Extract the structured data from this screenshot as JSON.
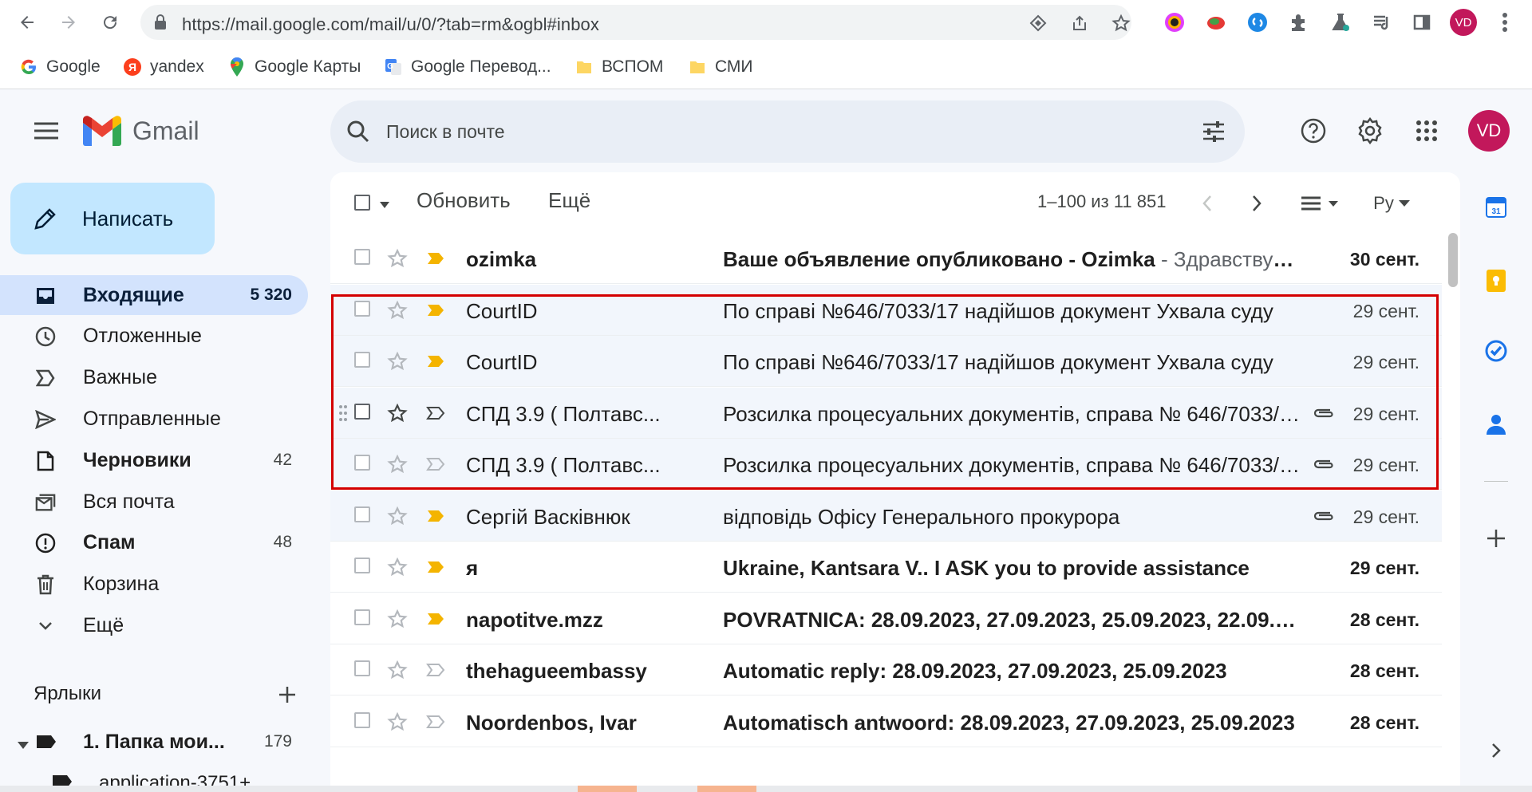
{
  "browser": {
    "url": "https://mail.google.com/mail/u/0/?tab=rm&ogbl#inbox",
    "profile_initials": "VD",
    "bookmarks": [
      {
        "label": "Google",
        "icon": "google-icon"
      },
      {
        "label": "yandex",
        "icon": "yandex-icon"
      },
      {
        "label": "Google Карты",
        "icon": "maps-icon"
      },
      {
        "label": "Google Перевод...",
        "icon": "translate-icon"
      },
      {
        "label": "ВСПОМ",
        "icon": "folder-icon"
      },
      {
        "label": "СМИ",
        "icon": "folder-icon"
      }
    ]
  },
  "header": {
    "app_name": "Gmail",
    "search_placeholder": "Поиск в почте",
    "avatar_initials": "VD"
  },
  "sidebar": {
    "compose_label": "Написать",
    "items": [
      {
        "label": "Входящие",
        "count": "5 320",
        "icon": "inbox-icon"
      },
      {
        "label": "Отложенные",
        "count": "",
        "icon": "clock-icon"
      },
      {
        "label": "Важные",
        "count": "",
        "icon": "important-icon"
      },
      {
        "label": "Отправленные",
        "count": "",
        "icon": "send-icon"
      },
      {
        "label": "Черновики",
        "count": "42",
        "icon": "draft-icon"
      },
      {
        "label": "Вся почта",
        "count": "",
        "icon": "all-mail-icon"
      },
      {
        "label": "Спам",
        "count": "48",
        "icon": "spam-icon"
      },
      {
        "label": "Корзина",
        "count": "",
        "icon": "trash-icon"
      },
      {
        "label": "Ещё",
        "count": "",
        "icon": "chevron-down-icon"
      }
    ],
    "labels_heading": "Ярлыки",
    "labels": [
      {
        "label": "1. Папка мои...",
        "count": "179"
      },
      {
        "label": "application-3751+",
        "count": ""
      }
    ]
  },
  "toolbar": {
    "refresh_label": "Обновить",
    "more_label": "Ещё",
    "page_count": "1–100 из 11 851",
    "input_tool": "Ру"
  },
  "emails": [
    {
      "sender": "ozimka",
      "subject": "Ваше объявление опубликовано - Ozimka",
      "snippet": " - Здравствуйте",
      "date": "30 сент.",
      "unread": true,
      "important": true,
      "attachment": false
    },
    {
      "sender": "CourtID",
      "subject": "По справі №646/7033/17 надійшов документ Ухвала суду",
      "snippet": "",
      "date": "29 сент.",
      "unread": false,
      "important": true,
      "attachment": false
    },
    {
      "sender": "CourtID",
      "subject": "По справі №646/7033/17 надійшов документ Ухвала суду",
      "snippet": "",
      "date": "29 сент.",
      "unread": false,
      "important": true,
      "attachment": false
    },
    {
      "sender": "СПД 3.9 ( Полтавс...",
      "subject": "Розсилка процесуальних документів, справа № 646/7033/17",
      "snippet": "",
      "date": "29 сент.",
      "unread": false,
      "important": false,
      "attachment": true
    },
    {
      "sender": "СПД 3.9 ( Полтавс...",
      "subject": "Розсилка процесуальних документів, справа № 646/7033/17",
      "snippet": "",
      "date": "29 сент.",
      "unread": false,
      "important": false,
      "attachment": true
    },
    {
      "sender": "Сергій Васківнюк",
      "subject": "відповідь Офісу Генерального прокурора",
      "snippet": "",
      "date": "29 сент.",
      "unread": false,
      "important": true,
      "attachment": true
    },
    {
      "sender": "я",
      "subject": "Ukraine, Kantsara V.. I ASK you to provide assistance",
      "snippet": "",
      "date": "29 сент.",
      "unread": true,
      "important": true,
      "attachment": false
    },
    {
      "sender": "napotitve.mzz",
      "subject": "POVRATNICA: 28.09.2023, 27.09.2023, 25.09.2023, 22.09.2023",
      "snippet": "",
      "date": "28 сент.",
      "unread": true,
      "important": true,
      "attachment": false
    },
    {
      "sender": "thehagueembassy",
      "subject": "Automatic reply: 28.09.2023, 27.09.2023, 25.09.2023",
      "snippet": "",
      "date": "28 сент.",
      "unread": true,
      "important": false,
      "attachment": false
    },
    {
      "sender": "Noordenbos, Ivar",
      "subject": "Automatisch antwoord: 28.09.2023, 27.09.2023, 25.09.2023",
      "snippet": "",
      "date": "28 сент.",
      "unread": true,
      "important": false,
      "attachment": false
    }
  ],
  "colors": {
    "accent": "#0b57d0",
    "important_marker": "#f4b400",
    "highlight_box": "#d40000",
    "avatar": "#c2185b"
  }
}
